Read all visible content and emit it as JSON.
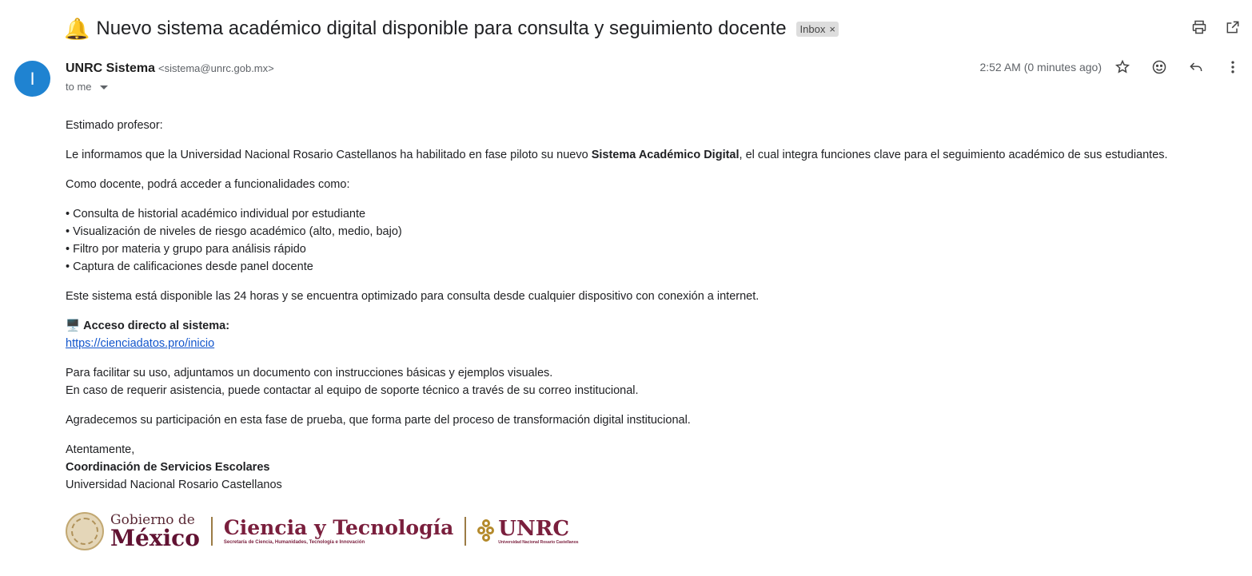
{
  "subject": {
    "emoji": "🔔",
    "text": "Nuevo sistema académico digital disponible para consulta y seguimiento docente",
    "label": "Inbox",
    "label_close": "×"
  },
  "toolbar": {
    "print_icon": "print-icon",
    "open_new_window_icon": "open-in-new-icon"
  },
  "sender": {
    "avatar_letter": "I",
    "avatar_color": "#1f83d1",
    "name": "UNRC Sistema",
    "email": "<sistema@unrc.gob.mx>",
    "to": "to me"
  },
  "meta": {
    "timestamp": "2:52 AM (0 minutes ago)",
    "icons": [
      "star-icon",
      "emoji-icon",
      "reply-icon",
      "more-vert-icon"
    ]
  },
  "body": {
    "greeting": "Estimado profesor:",
    "intro_pre": "Le informamos que la Universidad Nacional Rosario Castellanos ha habilitado en fase piloto su nuevo ",
    "intro_bold": "Sistema Académico Digital",
    "intro_post": ", el cual integra funciones clave para el seguimiento académico de sus estudiantes.",
    "features_intro": "Como docente, podrá acceder a funcionalidades como:",
    "features": [
      "• Consulta de historial académico individual por estudiante",
      "• Visualización de niveles de riesgo académico (alto, medio, bajo)",
      "• Filtro por materia y grupo para análisis rápido",
      "• Captura de calificaciones desde panel docente"
    ],
    "availability": "Este sistema está disponible las 24 horas y se encuentra optimizado para consulta desde cualquier dispositivo con conexión a internet.",
    "access_emoji": "🖥️",
    "access_label": "Acceso directo al sistema:",
    "access_link": "https://cienciadatos.pro/inicio",
    "help_line1": "Para facilitar su uso, adjuntamos un documento con instrucciones básicas y ejemplos visuales.",
    "help_line2": "En caso de requerir asistencia, puede contactar al equipo de soporte técnico a través de su correo institucional.",
    "thanks": "Agradecemos su participación en esta fase de prueba, que forma parte del proceso de transformación digital institucional.",
    "closing": "Atentamente,",
    "signature_org": "Coordinación de Servicios Escolares",
    "signature_univ": "Universidad Nacional Rosario Castellanos"
  },
  "footer": {
    "gob_line1": "Gobierno de",
    "gob_line2": "México",
    "cyt_title": "Ciencia y Tecnología",
    "cyt_sub": "Secretaría de Ciencia, Humanidades, Tecnología e Innovación",
    "unrc_title": "UNRC",
    "unrc_sub": "Universidad Nacional Rosario Castellanos"
  }
}
